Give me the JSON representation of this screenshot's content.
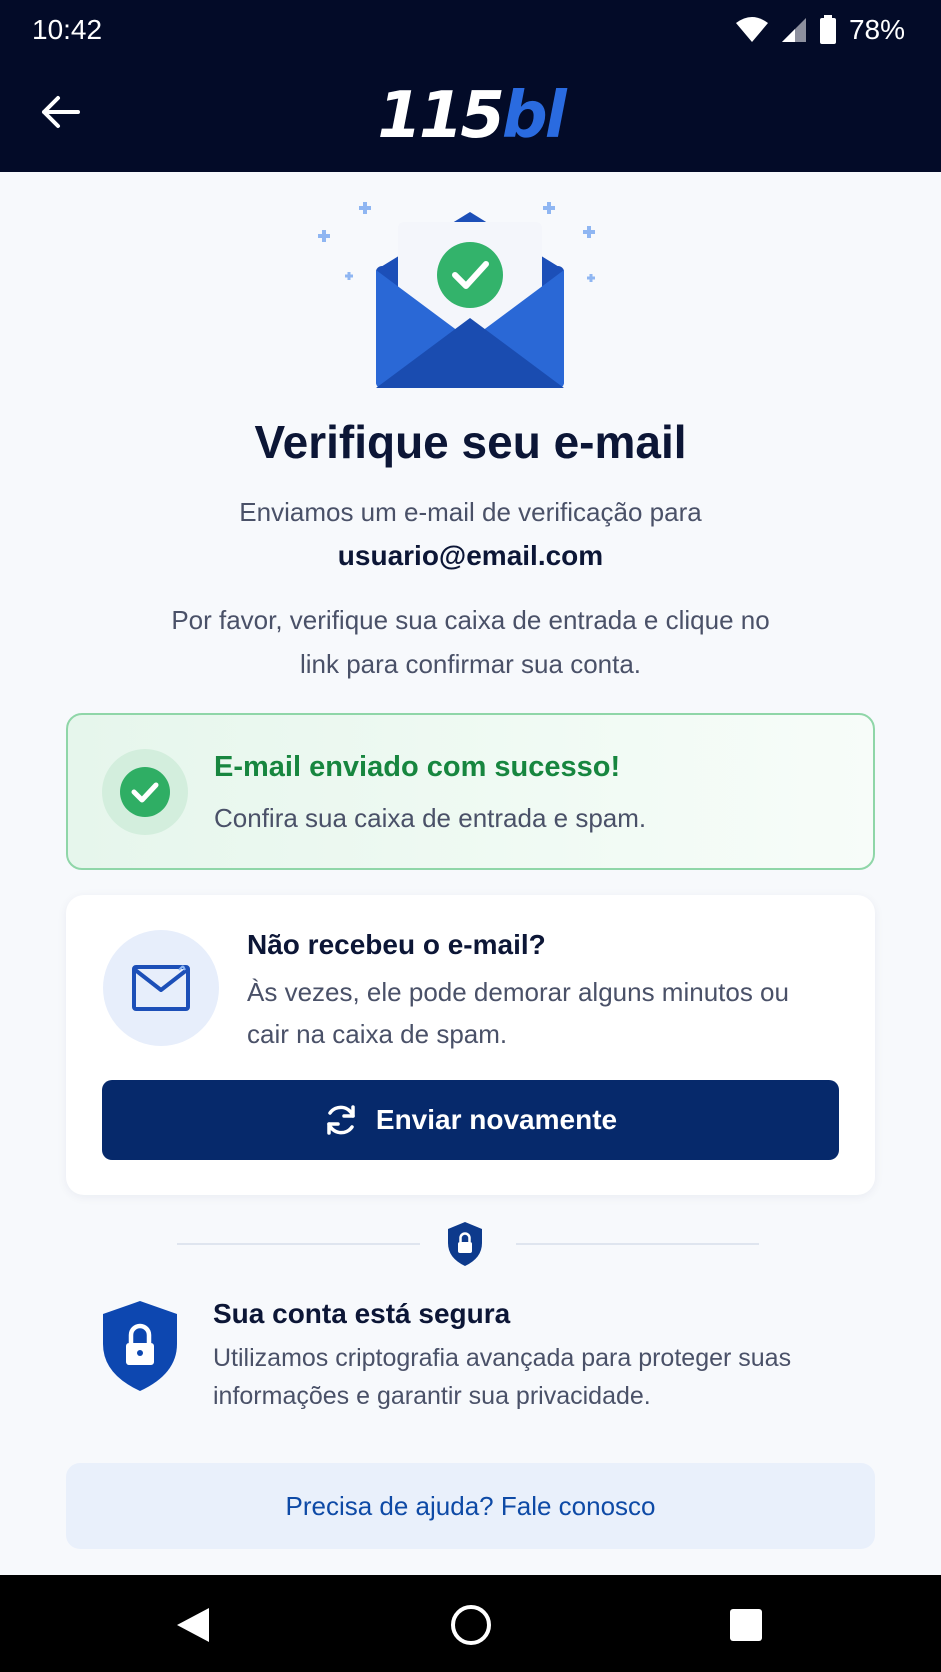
{
  "status_bar": {
    "time": "10:42",
    "battery": "78%",
    "icons": [
      "wifi-icon",
      "signal-icon",
      "battery-icon"
    ]
  },
  "app_bar": {
    "back_icon": "arrow-left-icon",
    "logo_part1": "115",
    "logo_part2": "bl"
  },
  "hero": {
    "icon": "envelope-check-icon"
  },
  "content": {
    "title": "Verifique seu e-mail",
    "subtitle": "Enviamos um e-mail de verificação para",
    "email": "usuario@email.com",
    "instructions": "Por favor, verifique sua caixa de entrada e clique no link para confirmar sua conta."
  },
  "success_card": {
    "title": "E-mail enviado com sucesso!",
    "text": "Confira sua caixa de entrada e spam."
  },
  "resend_card": {
    "title": "Não recebeu o e-mail?",
    "text": "Às vezes, ele pode demorar alguns minutos ou cair na caixa de spam.",
    "button_label": "Enviar novamente"
  },
  "security": {
    "title": "Sua conta está segura",
    "text": "Utilizamos criptografia avançada para proteger suas informações e garantir sua privacidade."
  },
  "help": {
    "label": "Precisa de ajuda? Fale conosco"
  },
  "nav_bar": {
    "items": [
      "back-triangle-icon",
      "home-circle-icon",
      "recents-square-icon"
    ]
  },
  "colors": {
    "header_bg": "#030b28",
    "brand_blue": "#2a6be0",
    "primary_button": "#06296b",
    "success_green": "#17863f",
    "help_bg": "#e9f0fb"
  }
}
